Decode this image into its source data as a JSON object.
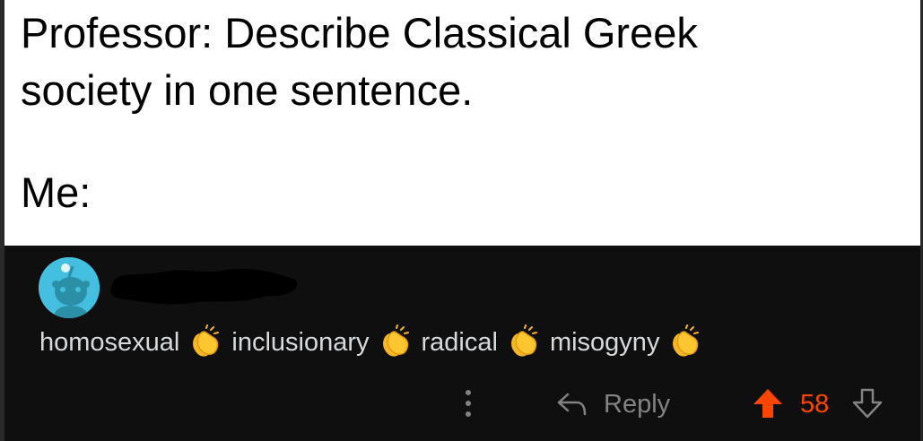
{
  "caption": {
    "line1": "Professor: Describe Classical Greek",
    "line2": "society in one sentence.",
    "line3": "Me:"
  },
  "comment": {
    "avatar_icon": "reddit-snoo-avatar-icon",
    "username_redacted": true,
    "words": [
      "homosexual",
      "inclusionary",
      "radical",
      "misogyny"
    ],
    "emoji_icon": "clapping-hands-icon",
    "actions": {
      "more_icon": "vertical-ellipsis-icon",
      "reply_label": "Reply",
      "upvote_icon": "upvote-arrow-icon",
      "score": "58",
      "downvote_icon": "downvote-arrow-icon"
    }
  },
  "colors": {
    "caption_bg": "#ffffff",
    "comment_bg": "#0f0f10",
    "avatar_bg": "#44bfe0",
    "upvote_active": "#ff4500",
    "muted_text": "#818384",
    "body_text": "#d7dadc"
  }
}
